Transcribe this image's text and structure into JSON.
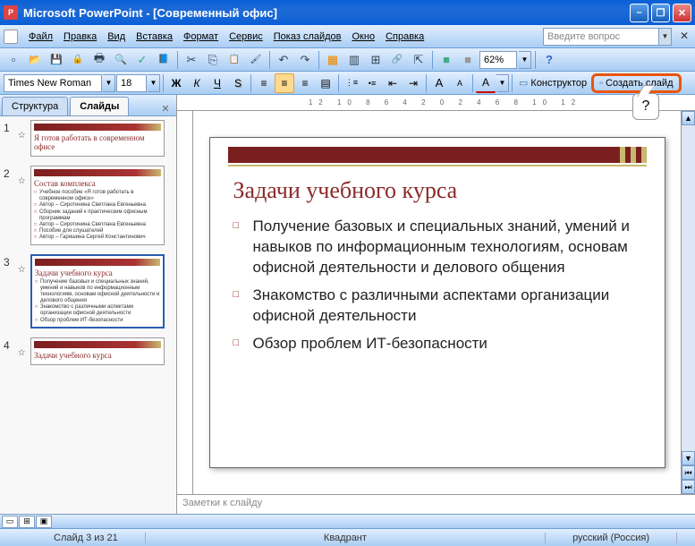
{
  "title": "Microsoft PowerPoint - [Современный офис]",
  "ask_box_placeholder": "Введите вопрос",
  "menu": {
    "file": "Файл",
    "edit": "Правка",
    "view": "Вид",
    "insert": "Вставка",
    "format": "Формат",
    "service": "Сервис",
    "slideshow": "Показ слайдов",
    "window": "Окно",
    "help": "Справка"
  },
  "toolbar": {
    "zoom": "62%"
  },
  "format": {
    "font": "Times New Roman",
    "size": "18",
    "bold": "Ж",
    "italic": "К",
    "underline": "Ч",
    "shadow": "S",
    "designer": "Конструктор",
    "new_slide": "Создать слайд"
  },
  "tooltip_hint": "?",
  "outline_tabs": {
    "structure": "Структура",
    "slides": "Слайды"
  },
  "thumbnails": [
    {
      "num": "1",
      "title": "Я готов работать в современном офисе",
      "lines": []
    },
    {
      "num": "2",
      "title": "Состав комплекса",
      "lines": [
        "Учебное пособие «Я готов работать в современном офисе»",
        "Автор – Сиротинина Светлана Евгеньевна",
        "Сборник заданий к практическим офисным программам",
        "Автор – Сиротинина Светлана Евгеньевна",
        "Пособие для слушателей",
        "Автор – Гаряшина Сергей Константинович"
      ]
    },
    {
      "num": "3",
      "title": "Задачи учебного курса",
      "lines": [
        "Получение базовых и специальных знаний, умений и навыков по информационным технологиям, основам офисной деятельности и делового общения",
        "Знакомство с различными аспектами организации офисной деятельности",
        "Обзор проблем ИТ-безопасности"
      ]
    },
    {
      "num": "4",
      "title": "Задачи учебного курса",
      "lines": []
    }
  ],
  "slide": {
    "title": "Задачи учебного курса",
    "bullets": [
      "Получение базовых и специальных знаний, умений и навыков по информационным технологиям, основам офисной деятельности и делового общения",
      "Знакомство с различными аспектами организации офисной деятельности",
      "Обзор проблем ИТ-безопасности"
    ]
  },
  "ruler_h": "12 10 8 6 4 2 0 2 4 6 8 10 12",
  "notes_placeholder": "Заметки к слайду",
  "status": {
    "slide": "Слайд 3 из 21",
    "layout": "Квадрант",
    "lang": "русский (Россия)"
  }
}
